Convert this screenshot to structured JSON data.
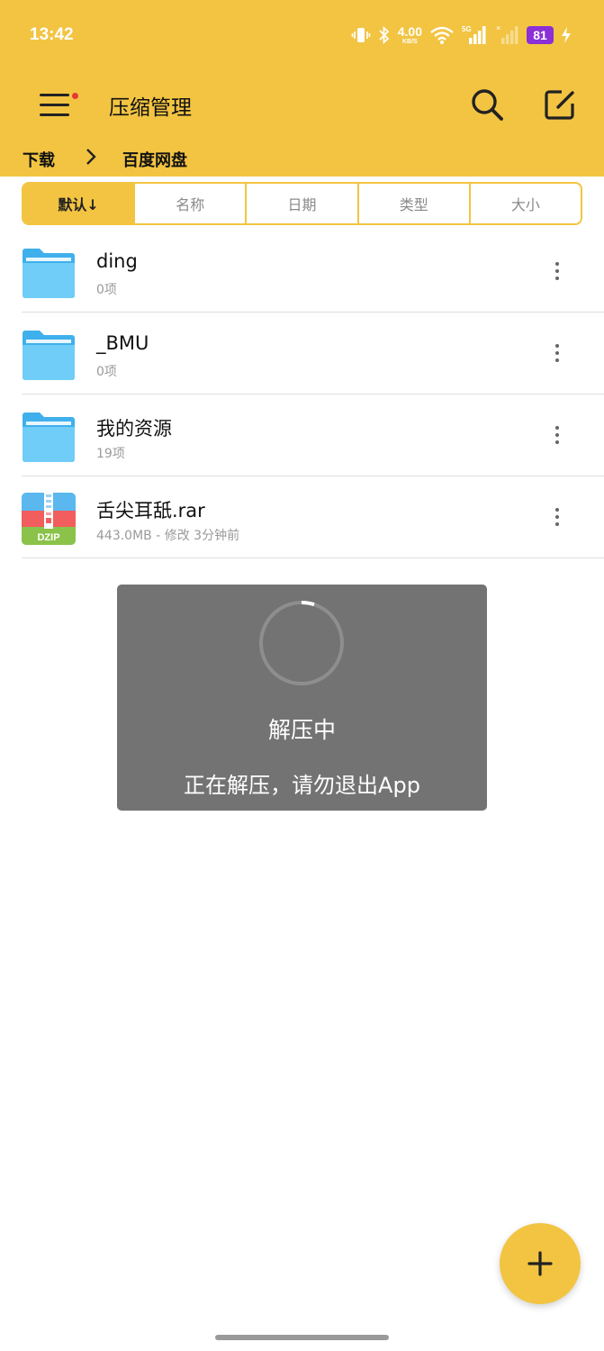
{
  "status_bar": {
    "time": "13:42",
    "net_speed_value": "4.00",
    "net_speed_unit": "KB/S",
    "network_label": "5G",
    "battery": "81"
  },
  "toolbar": {
    "title": "压缩管理",
    "icons": [
      "menu-icon",
      "search-icon",
      "edit-icon"
    ]
  },
  "breadcrumb": {
    "items": [
      "下载",
      "百度网盘"
    ],
    "separator_icon": "chevron-right-icon"
  },
  "sort": {
    "tabs": [
      {
        "label": "默认↓",
        "active": true
      },
      {
        "label": "名称",
        "active": false
      },
      {
        "label": "日期",
        "active": false
      },
      {
        "label": "类型",
        "active": false
      },
      {
        "label": "大小",
        "active": false
      }
    ]
  },
  "files": [
    {
      "name": "ding",
      "meta": "0项",
      "icon": "folder-icon"
    },
    {
      "name": "_BMU",
      "meta": "0项",
      "icon": "folder-icon"
    },
    {
      "name": "我的资源",
      "meta": "19项",
      "icon": "folder-icon"
    },
    {
      "name": "舌尖耳舐.rar",
      "meta": "443.0MB - 修改 3分钟前",
      "icon": "archive-icon",
      "icon_label": "DZIP"
    }
  ],
  "dialog": {
    "title": "解压中",
    "message": "正在解压，请勿退出App"
  },
  "fab": {
    "icon": "plus-icon"
  },
  "colors": {
    "accent": "#f2c442",
    "folder": "#6fcdf8",
    "dialog_bg": "#737373",
    "archive_top": "#5ab8ee",
    "archive_mid": "#f25d5d",
    "archive_bottom": "#8bc34a"
  }
}
